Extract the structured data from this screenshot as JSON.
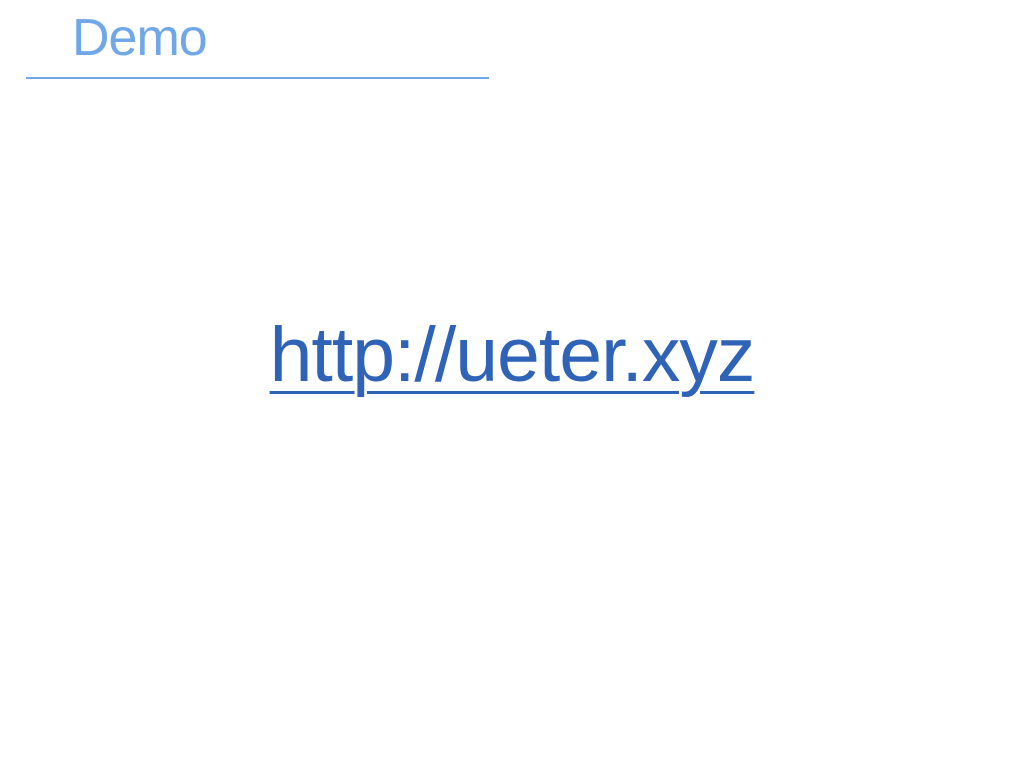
{
  "slide": {
    "title": "Demo",
    "link_text": "http://ueter.xyz"
  },
  "colors": {
    "title": "#6fa7e8",
    "rule": "#6fa7e8",
    "link": "#2f63b8",
    "background": "#ffffff"
  }
}
